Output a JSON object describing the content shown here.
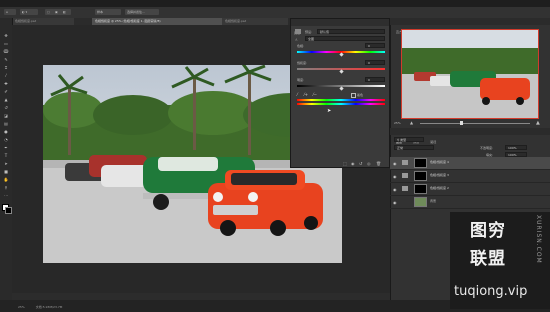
{
  "menubar": {
    "items": [
      "文件(F)",
      "编辑(E)",
      "图像(I)",
      "图层(L)",
      "文字(Y)",
      "选择(S)",
      "滤镜(T)",
      "3D(D)",
      "视图(V)",
      "窗口(W)",
      "帮助(H)"
    ]
  },
  "options": {
    "buttons": [
      "样本",
      "选择并遮住..."
    ]
  },
  "tabs": [
    {
      "label": "色相饱和度.psd"
    },
    {
      "label": "色相饱和度 @ 25% (色相/饱和度 1, 图层蒙版/8)"
    },
    {
      "label": "色相饱和度.psd"
    }
  ],
  "hue_panel": {
    "title": "属性",
    "preset_label": "预设:",
    "preset_value": "默认值",
    "channel_value": "全图",
    "hue_label": "色相:",
    "hue_value": "0",
    "sat_label": "饱和度:",
    "sat_value": "0",
    "light_label": "明度:",
    "light_value": "0",
    "colorize_label": "着色"
  },
  "navigator": {
    "tab_title": "导航器",
    "tab2": "直方图",
    "zoom": "25%"
  },
  "layers": {
    "tabs": [
      "图层",
      "通道",
      "路径"
    ],
    "blend_mode": "正常",
    "opacity_label": "不透明度:",
    "opacity_value": "100%",
    "fill_label": "填充:",
    "fill_value": "100%",
    "rows": [
      {
        "name": "色相/饱和度 4",
        "selected": true
      },
      {
        "name": "色相/饱和度 3",
        "selected": false
      },
      {
        "name": "色相/饱和度 2",
        "selected": false
      },
      {
        "name": "背景",
        "selected": false
      }
    ]
  },
  "status": {
    "zoom": "25%",
    "doc": "文档:5.93M/23.7M"
  },
  "watermark": {
    "line1": "图穷",
    "line2": "联盟",
    "side": "XURISN.COM",
    "url": "tuqiong.vip"
  }
}
